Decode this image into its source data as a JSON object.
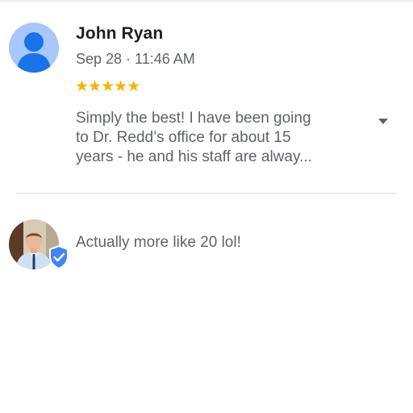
{
  "review": {
    "reviewer_name": "John Ryan",
    "date": "Sep 28 · 11:46 AM",
    "rating": 5,
    "stars_text": "★★★★★",
    "text_lines": [
      "Simply the best!  I have been going",
      "to Dr. Redd’s office for about 15",
      "years - he and his staff are alway..."
    ],
    "avatar_icon": "person-placeholder-icon",
    "expand_icon": "chevron-down-icon"
  },
  "owner_reply": {
    "text": "Actually more like 20 lol!",
    "avatar": "owner-photo",
    "badge_icon": "verified-shield-icon"
  },
  "colors": {
    "star": "#f6b400",
    "avatar_bg": "#a8c7fa",
    "avatar_fg": "#1a73e8",
    "verified": "#4285f4",
    "secondary_text": "#5f6368",
    "divider": "#dadce0"
  }
}
